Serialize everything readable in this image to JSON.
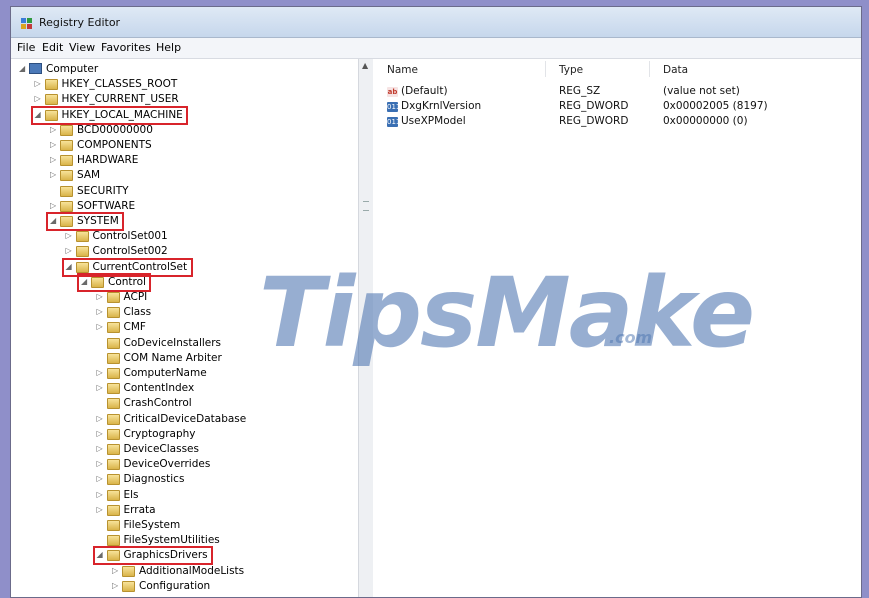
{
  "window": {
    "title": "Registry Editor"
  },
  "menu": [
    "File",
    "Edit",
    "View",
    "Favorites",
    "Help"
  ],
  "list": {
    "headers": {
      "name": "Name",
      "type": "Type",
      "data": "Data"
    },
    "rows": [
      {
        "icon": "ab",
        "icon_kind": "string-value-icon",
        "name": "(Default)",
        "type": "REG_SZ",
        "data": "(value not set)"
      },
      {
        "icon": "011",
        "icon_kind": "dword-value-icon",
        "name": "DxgKrnlVersion",
        "type": "REG_DWORD",
        "data": "0x00002005 (8197)"
      },
      {
        "icon": "011",
        "icon_kind": "dword-value-icon",
        "name": "UseXPModel",
        "type": "REG_DWORD",
        "data": "0x00000000 (0)"
      }
    ]
  },
  "tree": [
    {
      "label": "Computer",
      "depth": 0,
      "arrow": "expanded",
      "icon": "computer"
    },
    {
      "label": "HKEY_CLASSES_ROOT",
      "depth": 1,
      "arrow": "collapsed"
    },
    {
      "label": "HKEY_CURRENT_USER",
      "depth": 1,
      "arrow": "collapsed"
    },
    {
      "label": "HKEY_LOCAL_MACHINE",
      "depth": 1,
      "arrow": "expanded",
      "highlight": true
    },
    {
      "label": "BCD00000000",
      "depth": 2,
      "arrow": "collapsed"
    },
    {
      "label": "COMPONENTS",
      "depth": 2,
      "arrow": "collapsed"
    },
    {
      "label": "HARDWARE",
      "depth": 2,
      "arrow": "collapsed"
    },
    {
      "label": "SAM",
      "depth": 2,
      "arrow": "collapsed"
    },
    {
      "label": "SECURITY",
      "depth": 2,
      "arrow": "none"
    },
    {
      "label": "SOFTWARE",
      "depth": 2,
      "arrow": "collapsed"
    },
    {
      "label": "SYSTEM",
      "depth": 2,
      "arrow": "expanded",
      "highlight": true
    },
    {
      "label": "ControlSet001",
      "depth": 3,
      "arrow": "collapsed"
    },
    {
      "label": "ControlSet002",
      "depth": 3,
      "arrow": "collapsed"
    },
    {
      "label": "CurrentControlSet",
      "depth": 3,
      "arrow": "expanded",
      "highlight": true
    },
    {
      "label": "Control",
      "depth": 4,
      "arrow": "expanded",
      "highlight": true
    },
    {
      "label": "ACPI",
      "depth": 5,
      "arrow": "collapsed"
    },
    {
      "label": "Class",
      "depth": 5,
      "arrow": "collapsed"
    },
    {
      "label": "CMF",
      "depth": 5,
      "arrow": "collapsed"
    },
    {
      "label": "CoDeviceInstallers",
      "depth": 5,
      "arrow": "none"
    },
    {
      "label": "COM Name Arbiter",
      "depth": 5,
      "arrow": "none"
    },
    {
      "label": "ComputerName",
      "depth": 5,
      "arrow": "collapsed"
    },
    {
      "label": "ContentIndex",
      "depth": 5,
      "arrow": "collapsed"
    },
    {
      "label": "CrashControl",
      "depth": 5,
      "arrow": "none"
    },
    {
      "label": "CriticalDeviceDatabase",
      "depth": 5,
      "arrow": "collapsed"
    },
    {
      "label": "Cryptography",
      "depth": 5,
      "arrow": "collapsed"
    },
    {
      "label": "DeviceClasses",
      "depth": 5,
      "arrow": "collapsed"
    },
    {
      "label": "DeviceOverrides",
      "depth": 5,
      "arrow": "collapsed"
    },
    {
      "label": "Diagnostics",
      "depth": 5,
      "arrow": "collapsed"
    },
    {
      "label": "Els",
      "depth": 5,
      "arrow": "collapsed"
    },
    {
      "label": "Errata",
      "depth": 5,
      "arrow": "collapsed"
    },
    {
      "label": "FileSystem",
      "depth": 5,
      "arrow": "none"
    },
    {
      "label": "FileSystemUtilities",
      "depth": 5,
      "arrow": "none"
    },
    {
      "label": "GraphicsDrivers",
      "depth": 5,
      "arrow": "expanded",
      "highlight": true
    },
    {
      "label": "AdditionalModeLists",
      "depth": 6,
      "arrow": "collapsed"
    },
    {
      "label": "Configuration",
      "depth": 6,
      "arrow": "collapsed"
    }
  ],
  "watermark": {
    "main": "TipsMake",
    "suffix": ".com"
  },
  "colors": {
    "highlight": "#d8242b",
    "folder": "#e8c65c",
    "watermark": "#4c74b0"
  },
  "icons": {
    "arrow_expanded": "◢",
    "arrow_collapsed": "▷",
    "scroll_up": "▲"
  }
}
